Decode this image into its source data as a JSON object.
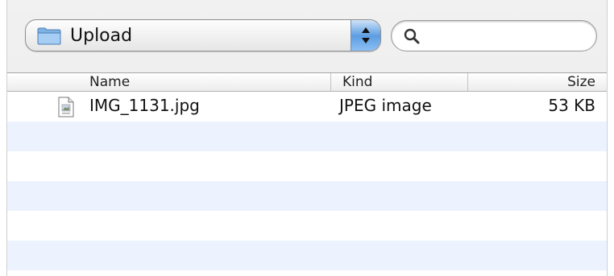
{
  "location_popup": {
    "selected": "Upload",
    "icon": "folder-icon"
  },
  "search": {
    "value": "",
    "icon": "magnifier-icon"
  },
  "columns": {
    "name": "Name",
    "kind": "Kind",
    "size": "Size"
  },
  "files": [
    {
      "name": "IMG_1131.jpg",
      "kind": "JPEG image",
      "size": "53 KB",
      "icon": "image-file-icon"
    }
  ],
  "colors": {
    "row_alt": "#edf3fe",
    "accent_blue": "#5c9de2"
  }
}
